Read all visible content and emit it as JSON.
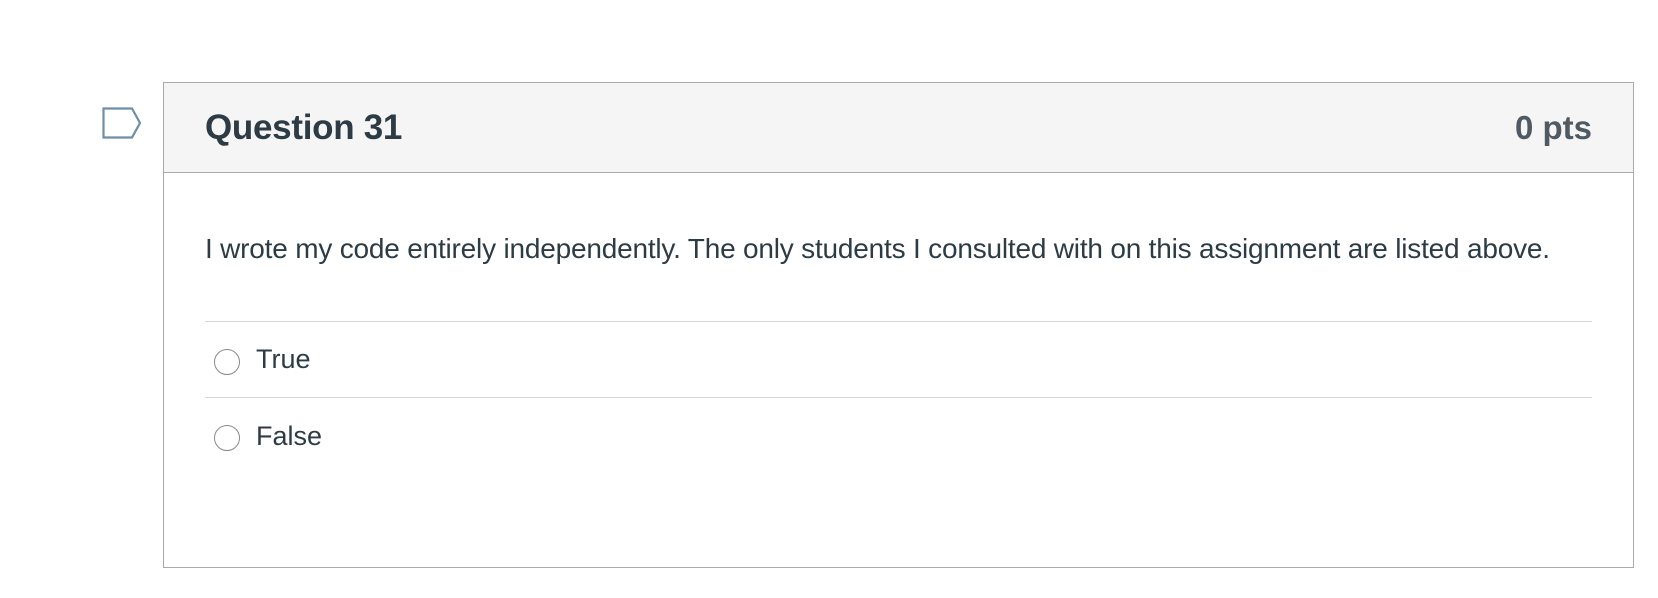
{
  "question": {
    "title": "Question 31",
    "points": "0 pts",
    "flag_icon": "flag-icon",
    "text": "I wrote my code entirely independently. The only students I consulted with on this assignment are listed above.",
    "answers": [
      {
        "label": "True",
        "selected": false
      },
      {
        "label": "False",
        "selected": false
      }
    ]
  },
  "colors": {
    "text": "#2d3b45",
    "header_bg": "#f5f5f5",
    "border": "#aaaaaa",
    "flag_stroke": "#6e8fa6"
  }
}
